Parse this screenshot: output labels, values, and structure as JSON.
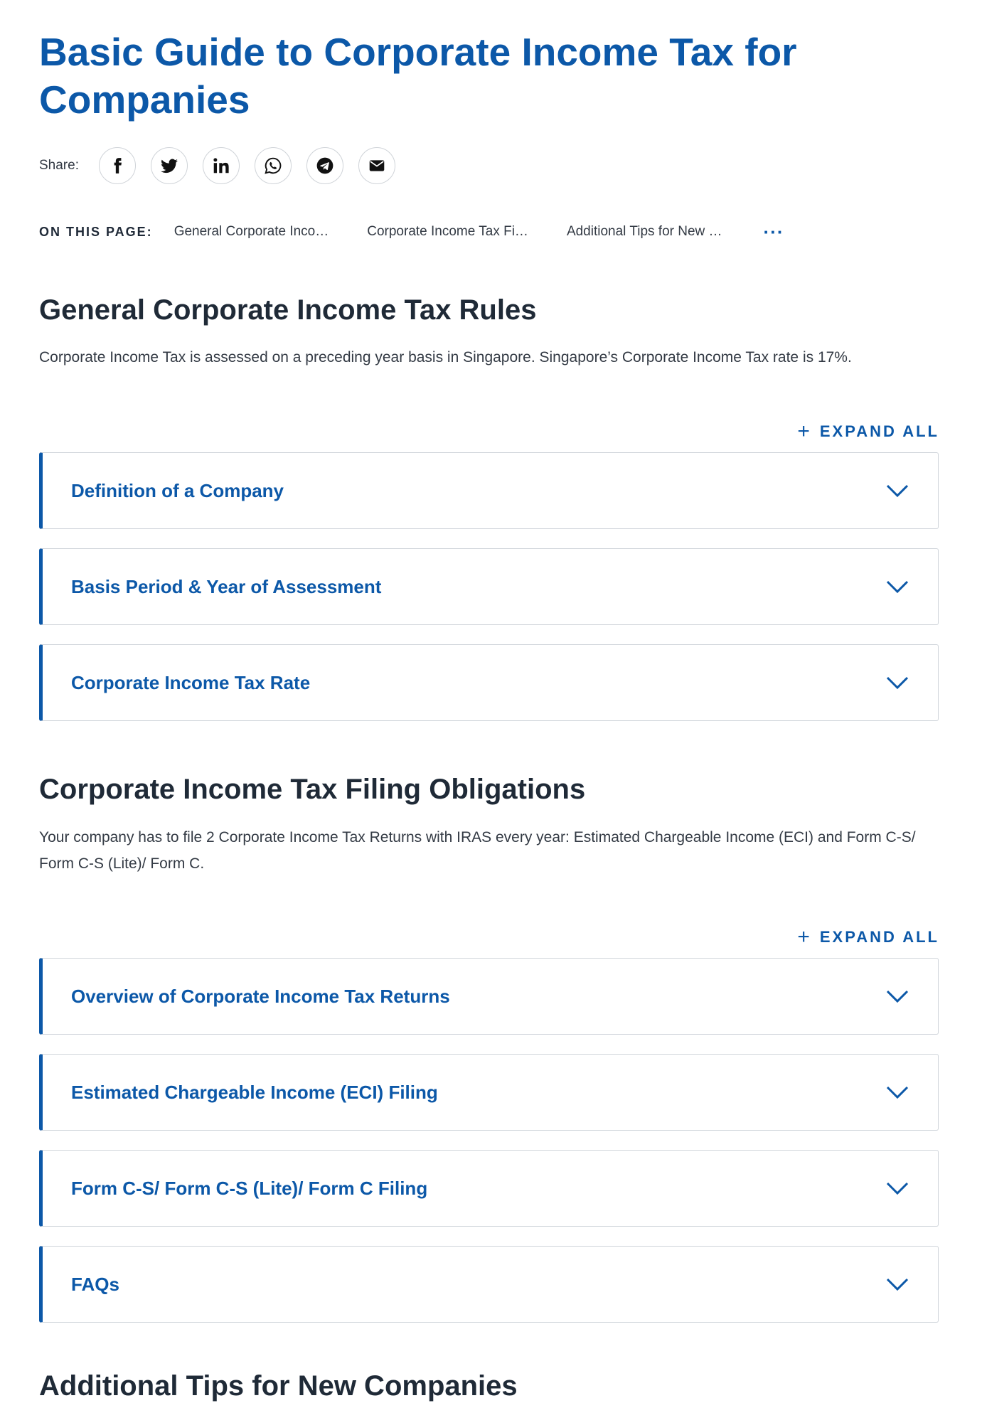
{
  "page": {
    "title": "Basic Guide to Corporate Income Tax for Companies"
  },
  "share": {
    "label": "Share:",
    "buttons": [
      {
        "icon": "facebook-icon"
      },
      {
        "icon": "twitter-icon"
      },
      {
        "icon": "linkedin-icon"
      },
      {
        "icon": "whatsapp-icon"
      },
      {
        "icon": "telegram-icon"
      },
      {
        "icon": "email-icon"
      }
    ]
  },
  "on_this_page": {
    "label": "ON THIS PAGE:",
    "links": [
      "General Corporate Inco…",
      "Corporate Income Tax Fi…",
      "Additional Tips for New …"
    ],
    "more": "···"
  },
  "sections": [
    {
      "heading": "General Corporate Income Tax Rules",
      "text": "Corporate Income Tax is assessed on a preceding year basis in Singapore. Singapore’s Corporate Income Tax rate is 17%.",
      "expand_all": "EXPAND ALL",
      "accordions": [
        "Definition of a Company",
        "Basis Period & Year of Assessment",
        "Corporate Income Tax Rate"
      ]
    },
    {
      "heading": "Corporate Income Tax Filing Obligations",
      "text": "Your company has to file 2 Corporate Income Tax Returns with IRAS every year: Estimated Chargeable Income (ECI) and Form C-S/ Form C-S (Lite)/ Form C.",
      "expand_all": "EXPAND ALL",
      "accordions": [
        "Overview of Corporate Income Tax Returns",
        "Estimated Chargeable Income (ECI) Filing",
        "Form C-S/ Form C-S (Lite)/ Form C Filing",
        "FAQs"
      ]
    },
    {
      "heading": "Additional Tips for New Companies"
    }
  ],
  "colors": {
    "brand": "#0c58a8",
    "heading": "#1f2a37",
    "body": "#333a44",
    "border": "#cfd4da"
  }
}
